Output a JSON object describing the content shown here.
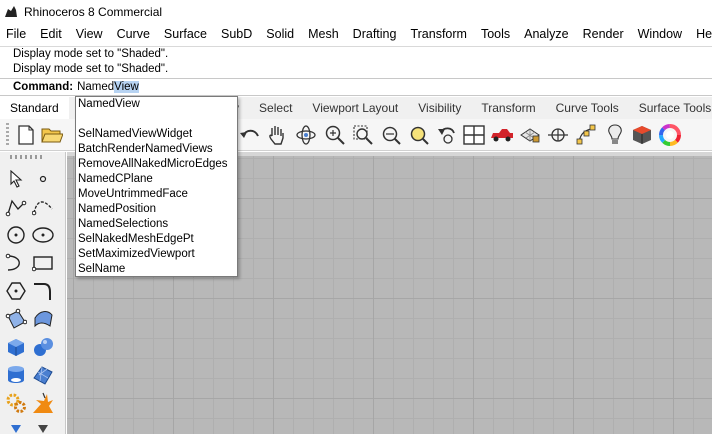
{
  "window": {
    "title": "Rhinoceros 8 Commercial"
  },
  "menu": [
    "File",
    "Edit",
    "View",
    "Curve",
    "Surface",
    "SubD",
    "Solid",
    "Mesh",
    "Drafting",
    "Transform",
    "Tools",
    "Analyze",
    "Render",
    "Window",
    "Help"
  ],
  "history": [
    "Display mode set to \"Shaded\".",
    "Display mode set to \"Shaded\"."
  ],
  "command": {
    "label": "Command:",
    "typed": "Named",
    "typed_selected": "View"
  },
  "tabs": [
    "Standard",
    "lay",
    "Select",
    "Viewport Layout",
    "Visibility",
    "Transform",
    "Curve Tools",
    "Surface Tools"
  ],
  "autocomplete": {
    "header": "NamedView",
    "items": [
      "SelNamedViewWidget",
      "BatchRenderNamedViews",
      "RemoveAllNakedMicroEdges",
      "NamedCPlane",
      "MoveUntrimmedFace",
      "NamedPosition",
      "NamedSelections",
      "SelNakedMeshEdgePt",
      "SetMaximizedViewport",
      "SelName"
    ]
  },
  "toolbar_icons": [
    "new-file-icon",
    "open-folder-icon",
    "undo-icon",
    "pan-hand-icon",
    "rotate-view-icon",
    "zoom-dynamic-icon",
    "zoom-window-icon",
    "zoom-extents-icon",
    "zoom-selected-icon",
    "undo-view-icon",
    "four-viewports-icon",
    "car-render-icon",
    "named-views-icon",
    "cplane-icon",
    "point-edit-icon",
    "light-bulb-icon",
    "material-icon",
    "color-wheel-icon"
  ],
  "sidebar_icons": [
    "select-arrow-icon",
    "point-icon",
    "polyline-icon",
    "curve-icon",
    "circle-icon",
    "ellipse-icon",
    "arc-icon",
    "rectangle-icon",
    "polygon-icon",
    "fillet-icon",
    "surface-corner-icon",
    "surface-edge-icon",
    "box-solid-icon",
    "sphere-solid-icon",
    "cylinder-icon",
    "mesh-surface-icon",
    "gear-icon",
    "explode-icon"
  ],
  "colors": {
    "accent": "#2b6cc4",
    "viewport_bg": "#b8b8b8",
    "selection": "#b7d3f2"
  }
}
